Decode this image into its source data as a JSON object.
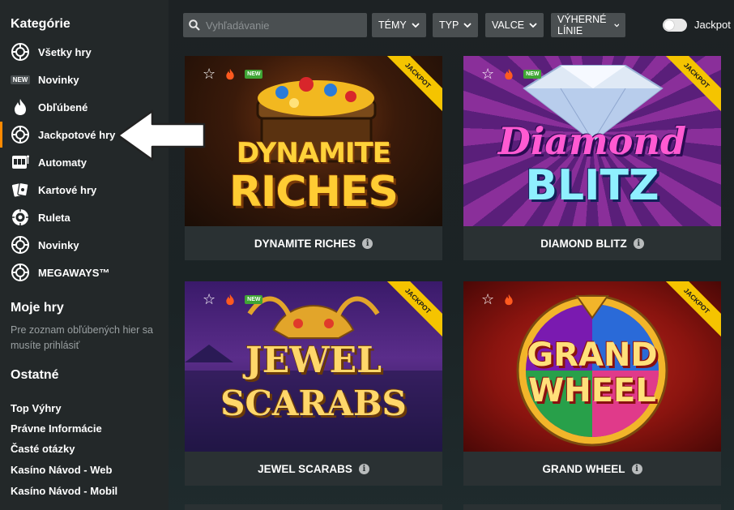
{
  "sidebar": {
    "categories_heading": "Kategórie",
    "items": [
      {
        "label": "Všetky hry",
        "icon": "chip-icon"
      },
      {
        "label": "Novinky",
        "icon": "new-badge-icon",
        "badge": "NEW"
      },
      {
        "label": "Obľúbené",
        "icon": "flame-icon"
      },
      {
        "label": "Jackpotové hry",
        "icon": "chip-icon",
        "active": true
      },
      {
        "label": "Automaty",
        "icon": "slot-machine-icon"
      },
      {
        "label": "Kartové hry",
        "icon": "cards-icon"
      },
      {
        "label": "Ruleta",
        "icon": "roulette-icon"
      },
      {
        "label": "Novinky",
        "icon": "chip-icon"
      },
      {
        "label": "MEGAWAYS™",
        "icon": "chip-icon"
      }
    ],
    "my_games_heading": "Moje hry",
    "my_games_note": "Pre zoznam obľúbených hier sa musíte prihlásiť",
    "other_heading": "Ostatné",
    "links": [
      "Top Výhry",
      "Právne Informácie",
      "Časté otázky",
      "Kasíno Návod - Web",
      "Kasíno Návod - Mobil"
    ]
  },
  "toolbar": {
    "search_placeholder": "Vyhľadávanie",
    "filters": [
      "TÉMY",
      "TYP",
      "VALCE",
      "VÝHERNÉ LÍNIE"
    ],
    "jackpot_toggle_label": "Jackpot"
  },
  "games": [
    {
      "title": "DYNAMITE RICHES",
      "art_line1": "DYNAMITE",
      "art_line2": "RICHES",
      "new_badge": "NEW",
      "ribbon": "JACKPOT"
    },
    {
      "title": "DIAMOND BLITZ",
      "art_line1": "Diamond",
      "art_line2": "BLITZ",
      "new_badge": "NEW",
      "ribbon": "JACKPOT"
    },
    {
      "title": "JEWEL SCARABS",
      "art_line1": "JEWEL",
      "art_line2": "SCARABS",
      "new_badge": "NEW",
      "ribbon": "JACKPOT"
    },
    {
      "title": "GRAND WHEEL",
      "art_line1": "GRAND",
      "art_line2": "WHEEL",
      "new_badge": "",
      "ribbon": "JACKPOT"
    }
  ],
  "colors": {
    "accent": "#ff8a00",
    "ribbon": "#f5c400",
    "new_badge": "#3fa535",
    "sidebar_bg": "#232829",
    "card_bg": "#2a3133"
  }
}
